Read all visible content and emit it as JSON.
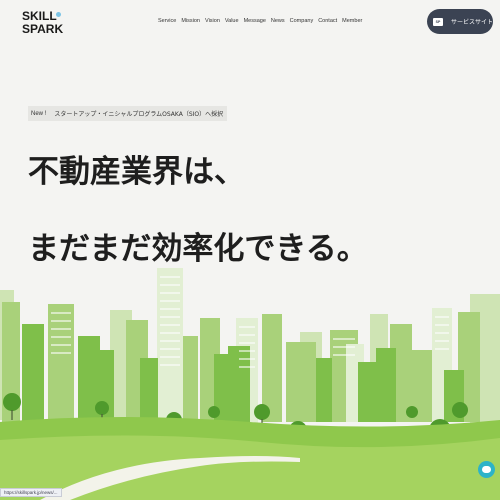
{
  "logo": {
    "line1": "SKILL",
    "line2": "SPARK"
  },
  "nav": {
    "items": [
      "Service",
      "Mission",
      "Vision",
      "Value",
      "Message",
      "News",
      "Company",
      "Contact",
      "Member"
    ]
  },
  "header": {
    "service_button_label": "サービスサイト",
    "service_icon_text": "SP"
  },
  "announcement": {
    "new_label": "New !",
    "text": "スタートアップ・イニシャルプログラムOSAKA（SIO）へ採択"
  },
  "hero": {
    "line1": "不動産業界は、",
    "line2": "まだまだ効率化できる。"
  },
  "status_url": "https://skillspark.jp/news/...",
  "colors": {
    "accent": "#8dc63f",
    "dark_button": "#3b4353",
    "chat": "#2db3c8",
    "background": "#f4f4f2"
  }
}
